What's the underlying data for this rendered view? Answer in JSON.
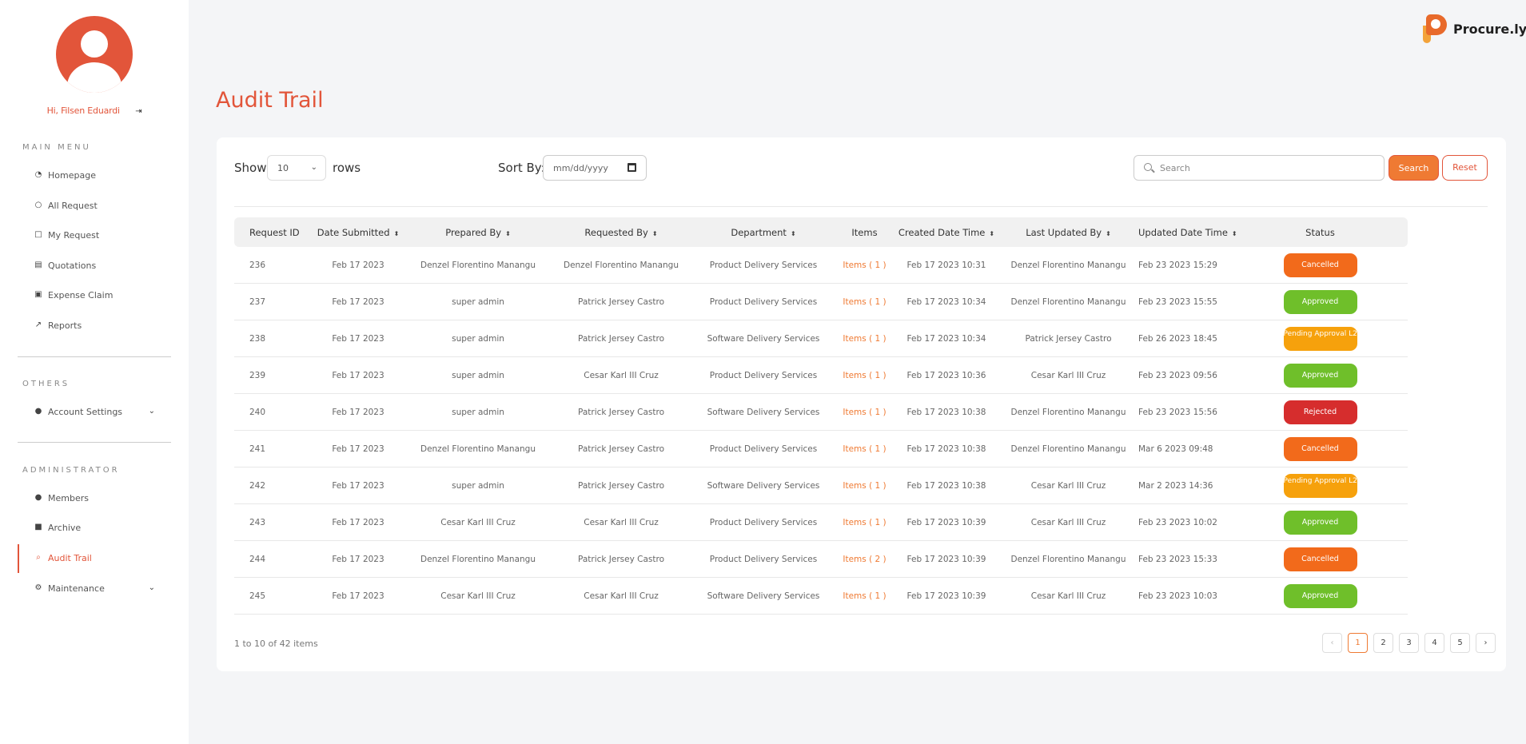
{
  "user": {
    "greeting": "Hi, Filsen Eduardi"
  },
  "brand": {
    "name": "Procure.ly",
    "accent": "#e2553a"
  },
  "sidebar": {
    "main_menu_title": "MAIN MENU",
    "main_items": [
      {
        "label": "Homepage",
        "icon": "dashboard-icon"
      },
      {
        "label": "All Request",
        "icon": "chat-icon"
      },
      {
        "label": "My Request",
        "icon": "note-icon"
      },
      {
        "label": "Quotations",
        "icon": "receipt-icon"
      },
      {
        "label": "Expense Claim",
        "icon": "money-icon"
      },
      {
        "label": "Reports",
        "icon": "chart-icon"
      }
    ],
    "others_title": "OTHERS",
    "others_items": [
      {
        "label": "Account Settings",
        "icon": "user-icon"
      }
    ],
    "admin_title": "ADMINISTRATOR",
    "admin_items": [
      {
        "label": "Members",
        "icon": "users-icon"
      },
      {
        "label": "Archive",
        "icon": "archive-icon"
      },
      {
        "label": "Audit Trail",
        "icon": "search-icon"
      },
      {
        "label": "Maintenance",
        "icon": "gears-icon"
      }
    ]
  },
  "page": {
    "title": "Audit Trail"
  },
  "controls": {
    "show_label": "Show",
    "rows_value": "10",
    "rows_label": "rows",
    "sort_label": "Sort By:",
    "date_placeholder": "mm/dd/yyyy",
    "search_placeholder": "Search",
    "search_button": "Search",
    "reset_button": "Reset"
  },
  "table": {
    "headers": [
      "Request ID",
      "Date Submitted",
      "Prepared By",
      "Requested By",
      "Department",
      "Items",
      "Created Date Time",
      "Last Updated By",
      "Updated Date Time",
      "Status"
    ],
    "rows": [
      [
        "236",
        "Feb 17 2023",
        "Denzel Florentino Manangu",
        "Denzel Florentino Manangu",
        "Product Delivery Services",
        "Items ( 1 )",
        "Feb 17 2023 10:31",
        "Denzel Florentino Manangu",
        "Feb 23 2023 15:29",
        "Cancelled"
      ],
      [
        "237",
        "Feb 17 2023",
        "super admin",
        "Patrick Jersey Castro",
        "Product Delivery Services",
        "Items ( 1 )",
        "Feb 17 2023 10:34",
        "Denzel Florentino Manangu",
        "Feb 23 2023 15:55",
        "Approved"
      ],
      [
        "238",
        "Feb 17 2023",
        "super admin",
        "Patrick Jersey Castro",
        "Software Delivery Services",
        "Items ( 1 )",
        "Feb 17 2023 10:34",
        "Patrick Jersey Castro",
        "Feb 26 2023 18:45",
        "Pending Approval L2"
      ],
      [
        "239",
        "Feb 17 2023",
        "super admin",
        "Cesar Karl III Cruz",
        "Product Delivery Services",
        "Items ( 1 )",
        "Feb 17 2023 10:36",
        "Cesar Karl III Cruz",
        "Feb 23 2023 09:56",
        "Approved"
      ],
      [
        "240",
        "Feb 17 2023",
        "super admin",
        "Patrick Jersey Castro",
        "Software Delivery Services",
        "Items ( 1 )",
        "Feb 17 2023 10:38",
        "Denzel Florentino Manangu",
        "Feb 23 2023 15:56",
        "Rejected"
      ],
      [
        "241",
        "Feb 17 2023",
        "Denzel Florentino Manangu",
        "Patrick Jersey Castro",
        "Product Delivery Services",
        "Items ( 1 )",
        "Feb 17 2023 10:38",
        "Denzel Florentino Manangu",
        "Mar 6 2023 09:48",
        "Cancelled"
      ],
      [
        "242",
        "Feb 17 2023",
        "super admin",
        "Patrick Jersey Castro",
        "Software Delivery Services",
        "Items ( 1 )",
        "Feb 17 2023 10:38",
        "Cesar Karl III Cruz",
        "Mar 2 2023 14:36",
        "Pending Approval L2"
      ],
      [
        "243",
        "Feb 17 2023",
        "Cesar Karl III Cruz",
        "Cesar Karl III Cruz",
        "Product Delivery Services",
        "Items ( 1 )",
        "Feb 17 2023 10:39",
        "Cesar Karl III Cruz",
        "Feb 23 2023 10:02",
        "Approved"
      ],
      [
        "244",
        "Feb 17 2023",
        "Denzel Florentino Manangu",
        "Patrick Jersey Castro",
        "Product Delivery Services",
        "Items ( 2 )",
        "Feb 17 2023 10:39",
        "Denzel Florentino Manangu",
        "Feb 23 2023 15:33",
        "Cancelled"
      ],
      [
        "245",
        "Feb 17 2023",
        "Cesar Karl III Cruz",
        "Cesar Karl III Cruz",
        "Software Delivery Services",
        "Items ( 1 )",
        "Feb 17 2023 10:39",
        "Cesar Karl III Cruz",
        "Feb 23 2023 10:03",
        "Approved"
      ]
    ]
  },
  "status_colors": {
    "Cancelled": "#f26a1b",
    "Approved": "#6fbf2a",
    "Pending Approval L2": "#f6a10c",
    "Rejected": "#d62d2d"
  },
  "footer": {
    "info": "1 to 10 of 42 items"
  },
  "pagination": {
    "prev": "‹",
    "next": "›",
    "pages": [
      "1",
      "2",
      "3",
      "4",
      "5"
    ],
    "current": "1"
  }
}
